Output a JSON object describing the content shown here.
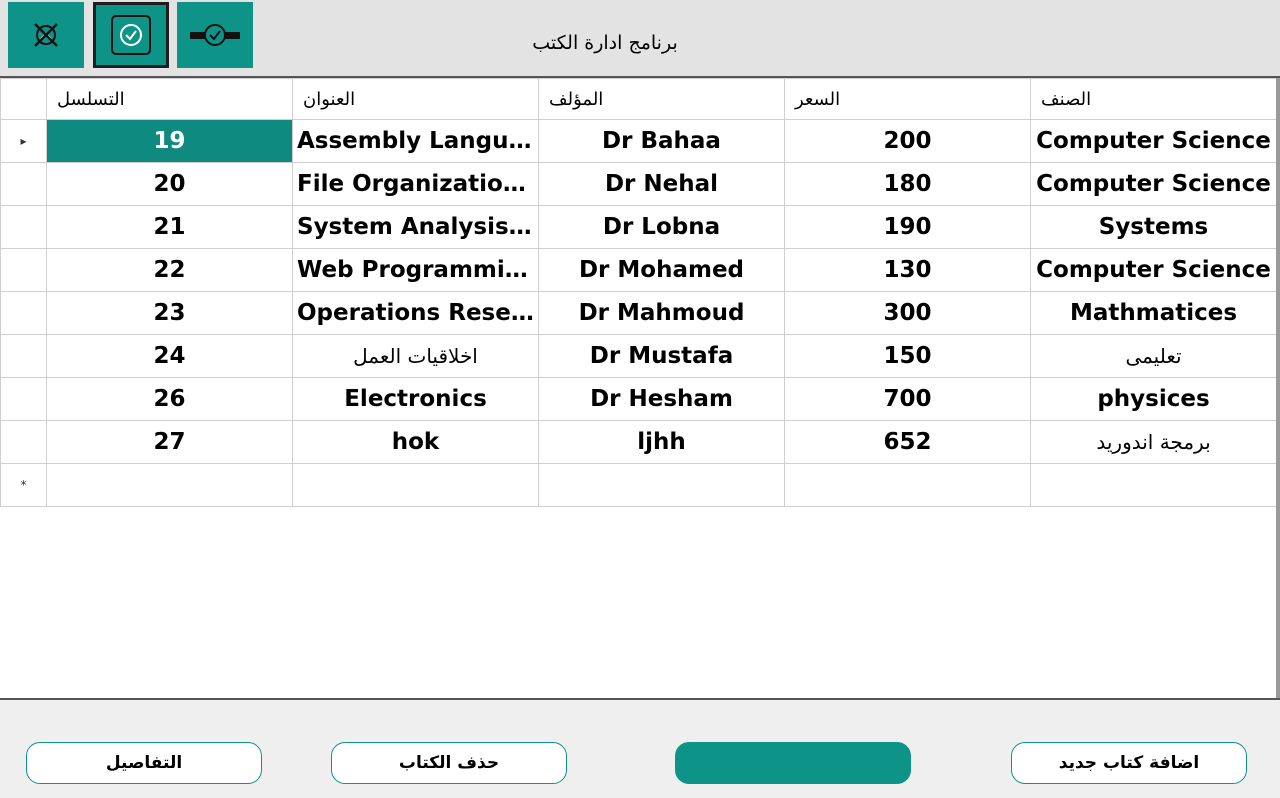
{
  "window": {
    "title": "برنامج ادارة  الكتب"
  },
  "toolbar": {
    "buttons": [
      {
        "icon": "close-circle-icon"
      },
      {
        "icon": "check-circle-icon"
      },
      {
        "icon": "minimize-icon"
      }
    ]
  },
  "grid": {
    "columns": [
      "التسلسل",
      "العنوان",
      "المؤلف",
      "السعر",
      "الصنف"
    ],
    "rows": [
      {
        "id": "19",
        "title": "Assembly Langua...",
        "author": "Dr Bahaa",
        "price": "200",
        "category": "Computer Science"
      },
      {
        "id": "20",
        "title": "File Organization...",
        "author": "Dr Nehal",
        "price": "180",
        "category": "Computer Science"
      },
      {
        "id": "21",
        "title": "System Analysis ...",
        "author": "Dr Lobna",
        "price": "190",
        "category": "Systems"
      },
      {
        "id": "22",
        "title": "Web Programming",
        "author": "Dr Mohamed",
        "price": "130",
        "category": "Computer Science"
      },
      {
        "id": "23",
        "title": "Operations Resea...",
        "author": "Dr Mahmoud",
        "price": "300",
        "category": "Mathmatices"
      },
      {
        "id": "24",
        "title": "اخلاقيات العمل",
        "author": "Dr Mustafa",
        "price": "150",
        "category": "تعليمى"
      },
      {
        "id": "26",
        "title": "Electronics",
        "author": "Dr Hesham",
        "price": "700",
        "category": "physices"
      },
      {
        "id": "27",
        "title": "hok",
        "author": "ljhh",
        "price": "652",
        "category": "برمجة اندوريد"
      }
    ],
    "current_row_marker": "▸",
    "new_row_marker": "*"
  },
  "footer": {
    "details_label": "التفاصيل",
    "delete_label": "حذف الكتاب",
    "update_label": "",
    "add_label": "اضافة كتاب جديد"
  },
  "colors": {
    "accent": "#0e9388",
    "selected_cell": "#0e8a80"
  }
}
